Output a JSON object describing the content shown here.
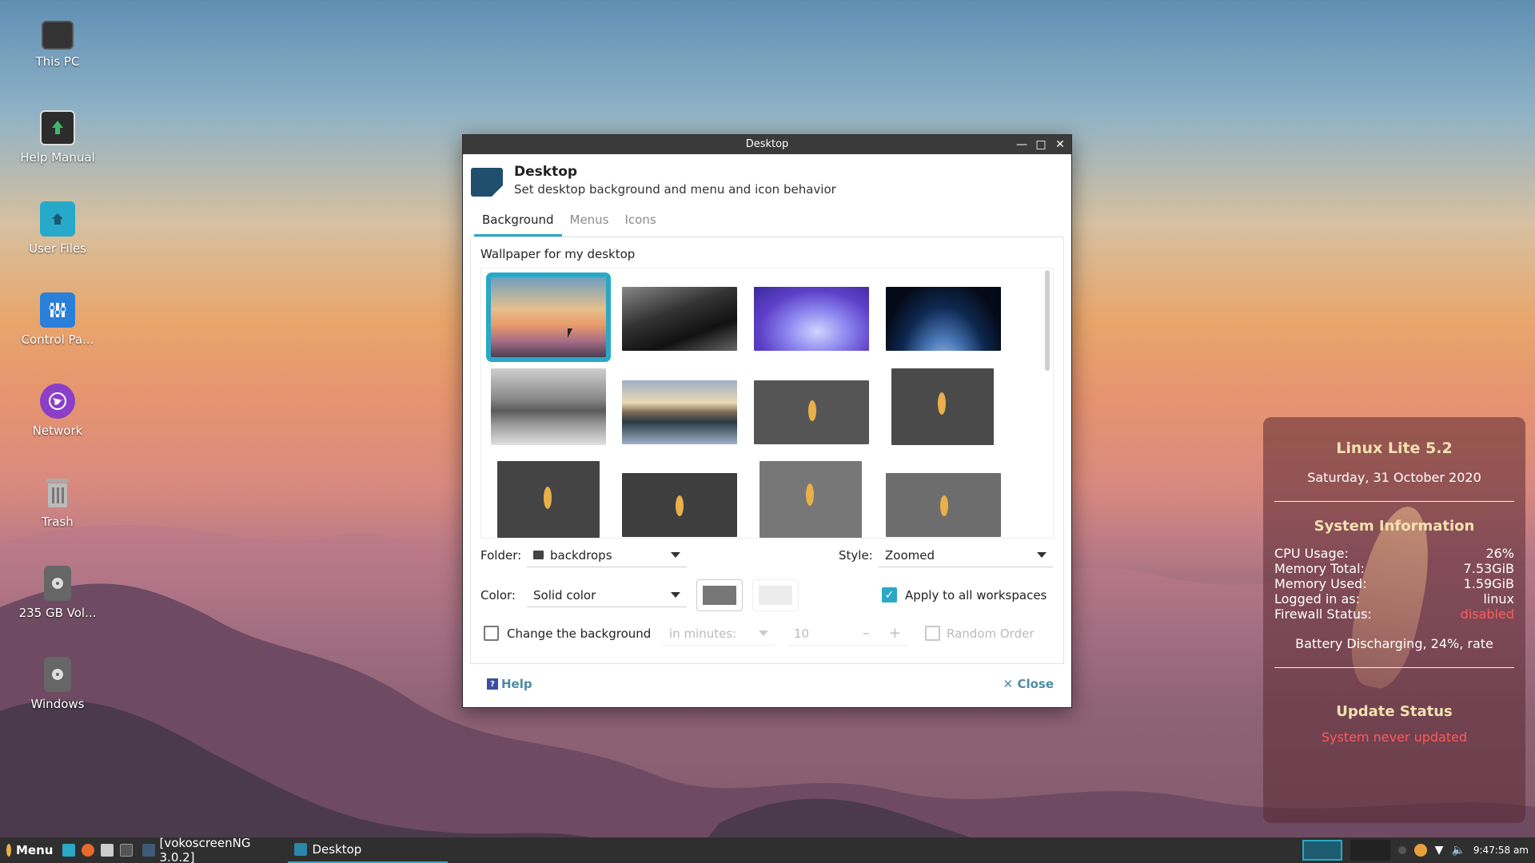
{
  "desktop_icons": [
    {
      "label": "This PC",
      "icon": "monitor-icon"
    },
    {
      "label": "Help Manual",
      "icon": "help-manual-icon"
    },
    {
      "label": "User Files",
      "icon": "home-folder-icon"
    },
    {
      "label": "Control Pa...",
      "icon": "control-panel-icon"
    },
    {
      "label": "Network",
      "icon": "network-globe-icon"
    },
    {
      "label": "Trash",
      "icon": "trash-icon"
    },
    {
      "label": "235 GB Vol...",
      "icon": "drive-icon"
    },
    {
      "label": "Windows",
      "icon": "drive-icon"
    }
  ],
  "window": {
    "title": "Desktop",
    "header_title": "Desktop",
    "header_subtitle": "Set desktop background and menu and icon behavior",
    "tabs": [
      "Background",
      "Menus",
      "Icons"
    ],
    "wallpaper_label": "Wallpaper for my desktop",
    "folder_label": "Folder:",
    "folder_value": "backdrops",
    "style_label": "Style:",
    "style_value": "Zoomed",
    "color_label": "Color:",
    "color_value": "Solid color",
    "apply_all_label": "Apply to all workspaces",
    "change_bg_label": "Change the background",
    "interval_value": "in minutes:",
    "minutes_value": "10",
    "random_order_label": "Random Order",
    "help_label": "Help",
    "close_label": "Close",
    "color_primary": "#777777",
    "color_secondary": "#ececec"
  },
  "conky": {
    "title": "Linux Lite 5.2",
    "date": "Saturday, 31 October 2020",
    "section_title": "System Information",
    "rows": [
      {
        "key": "CPU Usage:",
        "value": "26%"
      },
      {
        "key": "Memory Total:",
        "value": "7.53GiB"
      },
      {
        "key": "Memory Used:",
        "value": "1.59GiB"
      },
      {
        "key": "Logged in as:",
        "value": "linux"
      },
      {
        "key": "Firewall Status:",
        "value": "disabled"
      }
    ],
    "battery": "Battery Discharging, 24%, rate",
    "update_title": "Update Status",
    "update_status": "System never updated"
  },
  "taskbar": {
    "menu_label": "Menu",
    "items": [
      "[vokoscreenNG 3.0.2]",
      "Desktop"
    ],
    "clock": "9:47:58 am"
  }
}
